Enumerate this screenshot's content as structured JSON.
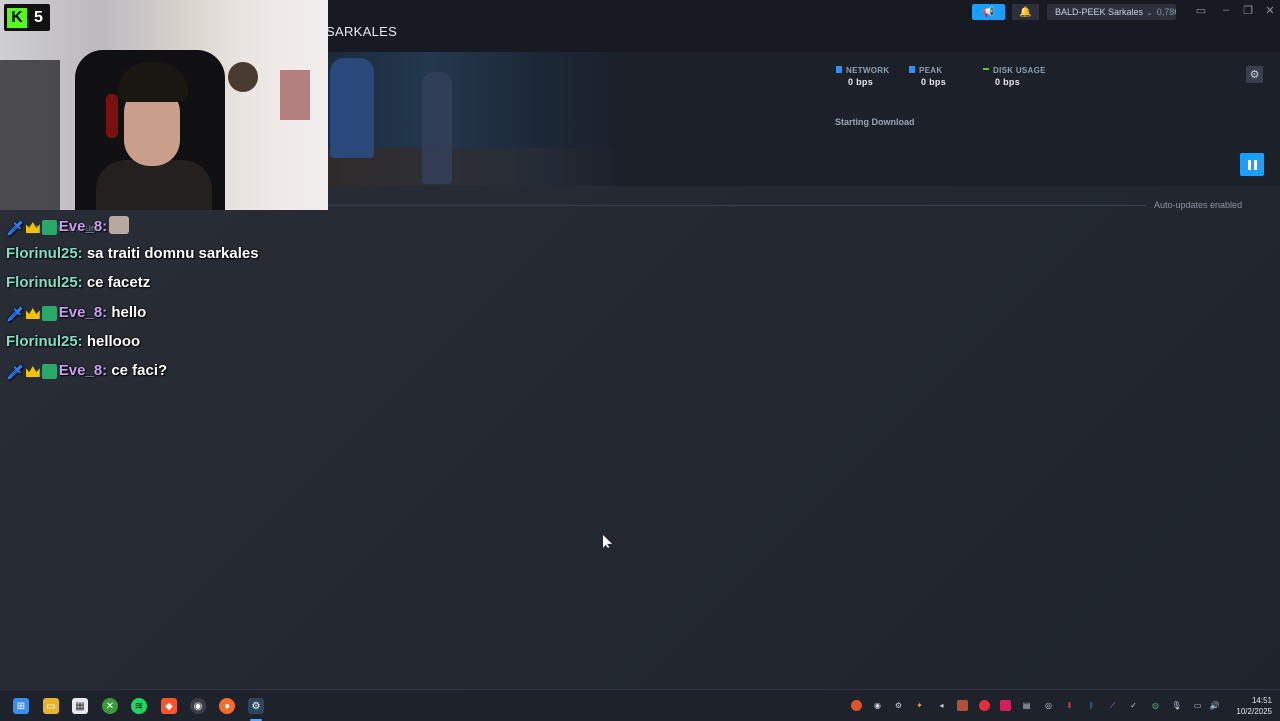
{
  "window": {
    "title": "SARKALES",
    "account_name": "BALD-PEEK Sarkales",
    "wallet": "0,78€",
    "controls": [
      "monitor-icon",
      "minimize-icon",
      "maximize-icon",
      "close-icon"
    ]
  },
  "downloads": {
    "stats": [
      {
        "label": "NETWORK",
        "value": "0 bps",
        "color": "#2f8ef0"
      },
      {
        "label": "PEAK",
        "value": "0 bps",
        "color": "#2f8ef0"
      },
      {
        "label": "DISK USAGE",
        "value": "0 bps",
        "color": "#5bc236"
      }
    ],
    "status": "Starting Download",
    "auto_updates": "Auto-updates enabled",
    "queue_text": "ds in the queue"
  },
  "stream": {
    "platform": "kick",
    "viewer_count": "5",
    "accent": "#53fc18"
  },
  "chat": [
    {
      "user": "Eve_8:",
      "message": "",
      "badges": true
    },
    {
      "user": "Florinul25:",
      "message": "sa traiti domnu sarkales",
      "badges": false
    },
    {
      "user": "Florinul25:",
      "message": "ce facetz",
      "badges": false
    },
    {
      "user": "Eve_8:",
      "message": "hello",
      "badges": true
    },
    {
      "user": "Florinul25:",
      "message": "hellooo",
      "badges": false
    },
    {
      "user": "Eve_8:",
      "message": "ce faci?",
      "badges": true
    }
  ],
  "taskbar": {
    "apps": [
      "windows-start-icon",
      "file-explorer-icon",
      "store-icon",
      "xbox-icon",
      "spotify-icon",
      "brave-icon",
      "obs-icon",
      "origin-icon",
      "steam-icon"
    ],
    "time": "14:51",
    "date": "10/2/2025"
  }
}
